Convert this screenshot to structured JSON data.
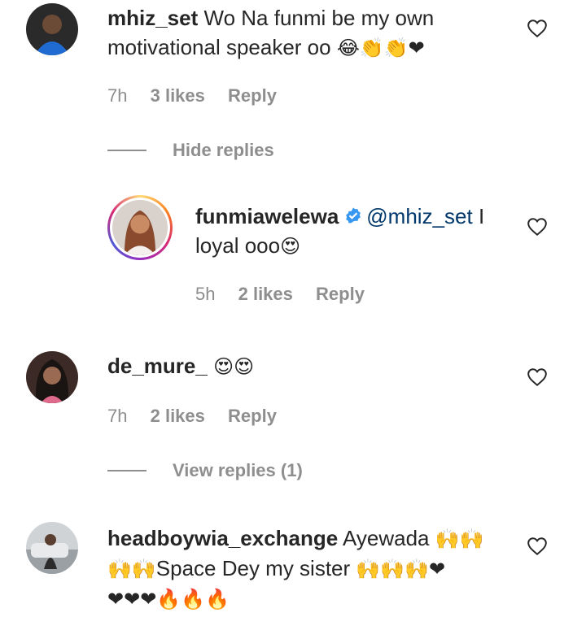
{
  "comments": [
    {
      "username": "mhiz_set",
      "text": "Wo Na funmi be my own motivational speaker oo",
      "emojis": "😂👏👏❤",
      "time": "7h",
      "likes": "3 likes",
      "reply_label": "Reply",
      "replies_toggle": "Hide replies"
    },
    {
      "username": "funmiawelewa",
      "mention": "@mhiz_set",
      "text_line1": " I",
      "text_line2": "loyal ooo",
      "emojis": "😍",
      "time": "5h",
      "likes": "2 likes",
      "reply_label": "Reply"
    },
    {
      "username": "de_mure_",
      "emojis": "😍😍",
      "time": "7h",
      "likes": "2 likes",
      "reply_label": "Reply",
      "replies_toggle": "View replies (1)"
    },
    {
      "username": "headboywia_exchange",
      "text": "Ayewada",
      "emojis_line1": "🙌🙌",
      "emojis_line2_pre": "🙌🙌",
      "text_line2": "Space Dey my sister",
      "emojis_line2_post": "🙌🙌🙌❤",
      "emojis_line3": "❤❤❤🔥🔥🔥"
    }
  ],
  "colors": {
    "username": "#262626",
    "meta": "#8e8e8e",
    "mention": "#00376b",
    "verified": "#3897f0",
    "heart_emoji": "#e0457b"
  },
  "icons": {
    "like": "heart-outline-icon",
    "verified": "verified-badge-icon"
  }
}
